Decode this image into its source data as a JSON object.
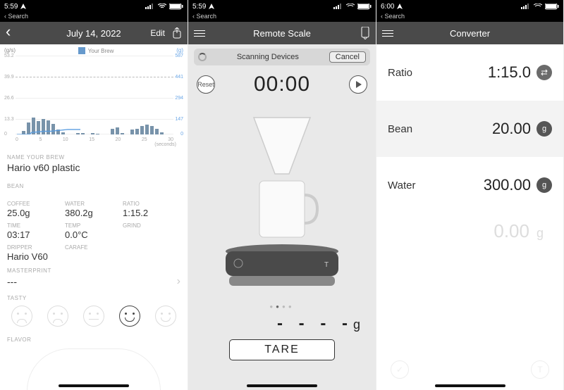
{
  "screen1": {
    "status": {
      "time": "5:59",
      "back": "Search"
    },
    "nav": {
      "title": "July 14, 2022",
      "edit": "Edit"
    },
    "chart": {
      "legend": "Your Brew",
      "y_left_unit": "(g/s)",
      "y_right_unit": "(g)",
      "y_left": [
        "53.2",
        "39.9",
        "26.6",
        "13.3",
        "0"
      ],
      "y_right": [
        "587",
        "441",
        "294",
        "147",
        "0"
      ],
      "x_ticks": [
        "0",
        "5",
        "10",
        "15",
        "20",
        "25",
        "30"
      ],
      "x_label": "(seconds)"
    },
    "name_label": "NAME YOUR BREW",
    "name_value": "Hario v60 plastic",
    "bean_label": "BEAN",
    "stats1": {
      "coffee_l": "COFFEE",
      "coffee_v": "25.0g",
      "water_l": "WATER",
      "water_v": "380.2g",
      "ratio_l": "RATIO",
      "ratio_v": "1:15.2"
    },
    "stats2": {
      "time_l": "TIME",
      "time_v": "03:17",
      "temp_l": "TEMP",
      "temp_v": "0.0°C",
      "grind_l": "GRIND",
      "grind_v": ""
    },
    "dripper_l": "DRIPPER",
    "dripper_v": "Hario V60",
    "carafe_l": "CARAFE",
    "master_l": "MASTERPRINT",
    "master_v": "---",
    "tasty_l": "TASTY",
    "flavor_l": "FLAVOR"
  },
  "screen2": {
    "status": {
      "time": "5:59",
      "back": "Search"
    },
    "nav": {
      "title": "Remote Scale"
    },
    "scan_text": "Scanning Devices",
    "cancel": "Cancel",
    "reset": "Reset",
    "timer": "00:00",
    "weight": "- - - -",
    "weight_unit": "g",
    "tare": "TARE"
  },
  "screen3": {
    "status": {
      "time": "6:00",
      "back": "Search"
    },
    "nav": {
      "title": "Converter"
    },
    "rows": {
      "ratio": {
        "label": "Ratio",
        "value": "1:15.0"
      },
      "bean": {
        "label": "Bean",
        "value": "20.00",
        "unit": "g"
      },
      "water": {
        "label": "Water",
        "value": "300.00",
        "unit": "g"
      }
    },
    "extra_value": "0.00",
    "extra_unit": "g"
  },
  "chart_data": {
    "type": "bar",
    "x": [
      0,
      1,
      2,
      3,
      4,
      5,
      6,
      7,
      8,
      9,
      10,
      11,
      12,
      13,
      14,
      15,
      16,
      17,
      18,
      19,
      20,
      21,
      22,
      23,
      24,
      25,
      26,
      27,
      28,
      29,
      30
    ],
    "bar_values_gps": [
      0,
      3,
      10,
      14,
      11,
      13,
      12,
      9,
      4,
      2,
      0,
      0,
      1,
      1,
      0,
      1,
      0.5,
      0,
      0,
      5,
      6,
      1,
      0,
      4,
      5,
      7,
      8,
      7,
      5,
      2,
      0
    ],
    "line_values_g": [
      0,
      0,
      0,
      0,
      0,
      0,
      0,
      20,
      20,
      22,
      24,
      26,
      28,
      30,
      30,
      30,
      30,
      32,
      34,
      36,
      38,
      40,
      42,
      44,
      46,
      46,
      46,
      46,
      46,
      46,
      46
    ],
    "dashed_ref_gps": 39.9,
    "xlabel": "(seconds)",
    "y_left_label": "(g/s)",
    "y_left_lim": [
      0,
      53.2
    ],
    "y_right_label": "(g)",
    "y_right_lim": [
      0,
      587
    ],
    "legend": [
      "Your Brew"
    ]
  }
}
